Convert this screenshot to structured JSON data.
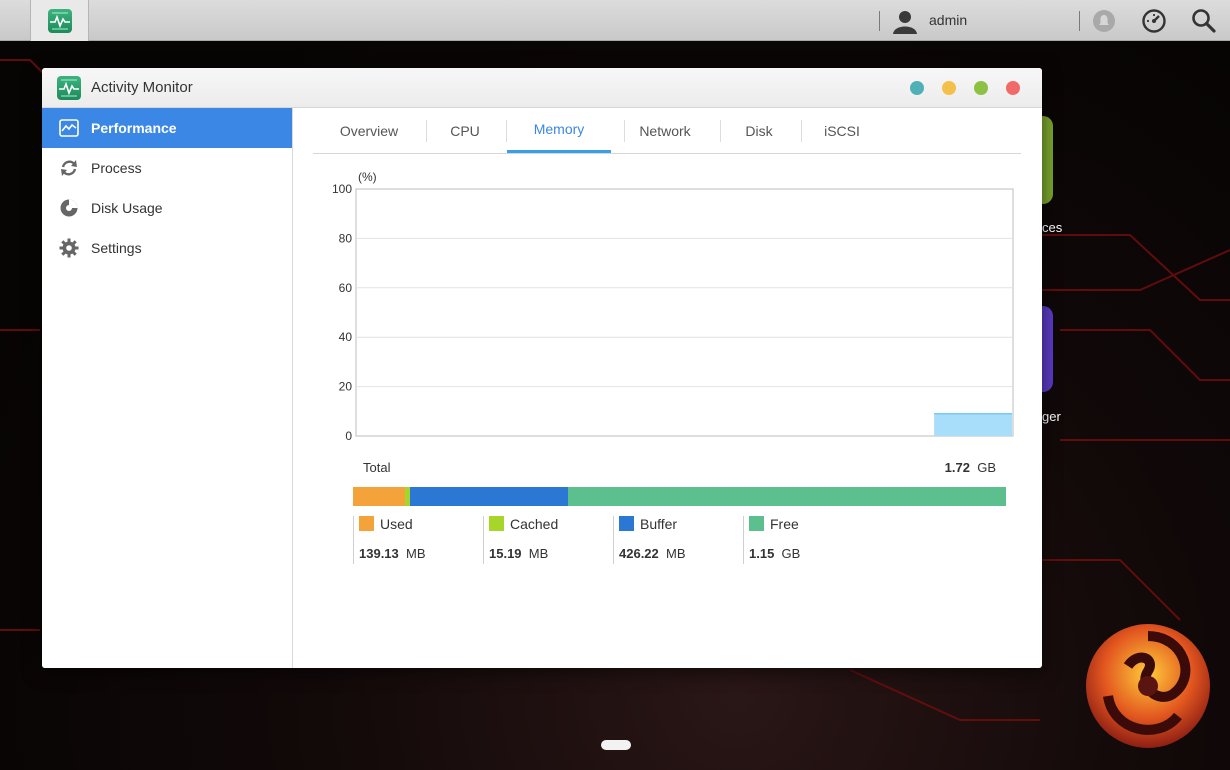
{
  "topbar": {
    "username": "admin"
  },
  "window": {
    "title": "Activity Monitor",
    "buttons": {
      "teal": "#4fb0b6",
      "yellow": "#f3c04c",
      "green": "#8dc144",
      "red": "#f06a6a"
    }
  },
  "sidebar": {
    "items": [
      {
        "label": "Performance",
        "icon": "performance-icon",
        "active": true
      },
      {
        "label": "Process",
        "icon": "process-icon"
      },
      {
        "label": "Disk Usage",
        "icon": "disk-usage-icon"
      },
      {
        "label": "Settings",
        "icon": "gear-icon"
      }
    ]
  },
  "tabs": [
    {
      "label": "Overview"
    },
    {
      "label": "CPU"
    },
    {
      "label": "Memory",
      "active": true
    },
    {
      "label": "Network"
    },
    {
      "label": "Disk"
    },
    {
      "label": "iSCSI"
    }
  ],
  "chart_data": {
    "type": "area",
    "ylabel": "(%)",
    "ylim": [
      0,
      100
    ],
    "yticks": [
      "100",
      "80",
      "60",
      "40",
      "20",
      "0"
    ],
    "grid": true,
    "series": [
      {
        "color": "#a8defa",
        "values_start_fraction": 0.88,
        "value": 9
      }
    ]
  },
  "memory": {
    "total_label": "Total",
    "total_value": "1.72",
    "total_unit": "GB",
    "segments": [
      {
        "name": "Used",
        "value": "139.13",
        "unit": "MB",
        "color": "#f4a23a",
        "fraction": 0.079
      },
      {
        "name": "Cached",
        "value": "15.19",
        "unit": "MB",
        "color": "#a6d62a",
        "fraction": 0.0086
      },
      {
        "name": "Buffer",
        "value": "426.22",
        "unit": "MB",
        "color": "#2a77d4",
        "fraction": 0.242
      },
      {
        "name": "Free",
        "value": "1.15",
        "unit": "GB",
        "color": "#5cc08e",
        "fraction": 0.6704
      }
    ]
  },
  "desktop": {
    "tile_label_1": "ces",
    "tile_label_2": "ger"
  }
}
